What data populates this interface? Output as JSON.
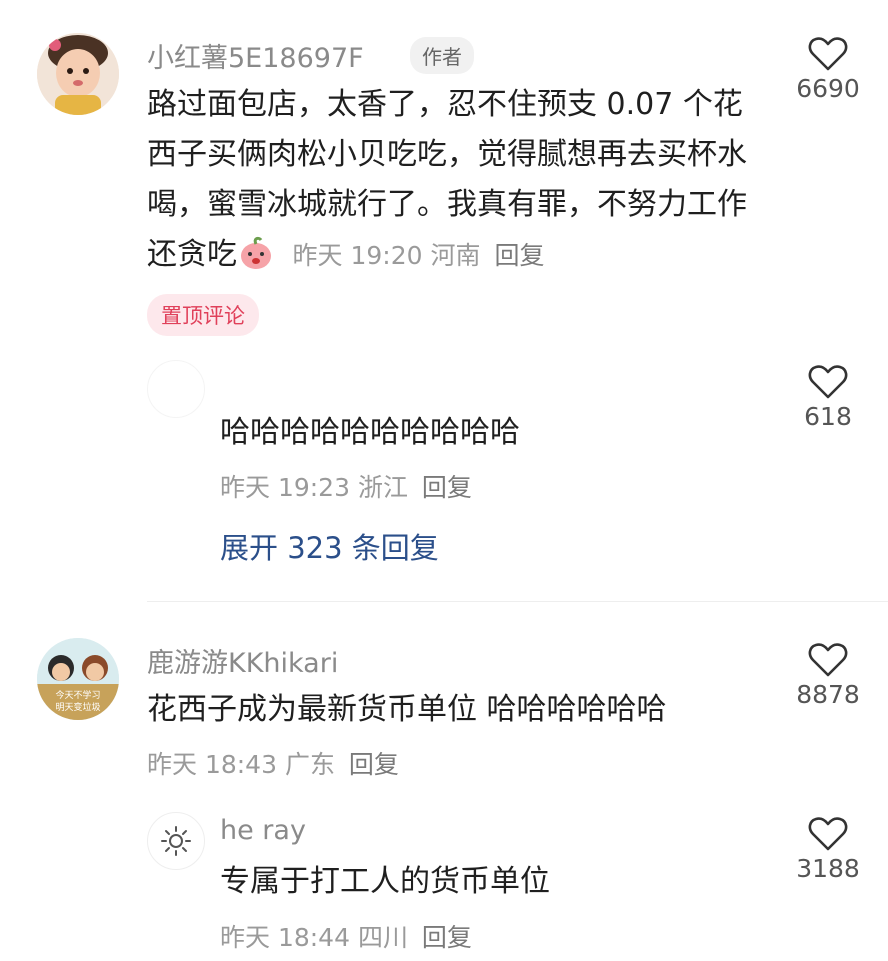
{
  "comments": [
    {
      "name": "小红薯5E18697F",
      "author_tag": "作者",
      "text_before_sticker": "路过面包店，太香了，忍不住预支 0.07 个花西子买俩肉松小贝吃吃，觉得腻想再去买杯水喝，蜜雪冰城就行了。我真有罪，不努力工作还贪吃",
      "time": "昨天 19:20",
      "location": "河南",
      "reply_label": "回复",
      "likes": "6690",
      "pinned_label": "置顶评论",
      "replies": [
        {
          "name": "",
          "text": "哈哈哈哈哈哈哈哈哈哈",
          "time": "昨天 19:23",
          "location": "浙江",
          "reply_label": "回复",
          "likes": "618"
        }
      ],
      "expand_label": "展开 323 条回复"
    },
    {
      "name": "鹿游游KKhikari",
      "text": "花西子成为最新货币单位 哈哈哈哈哈哈",
      "time": "昨天 18:43",
      "location": "广东",
      "reply_label": "回复",
      "likes": "8878",
      "avatar_caption_1": "今天不学习",
      "avatar_caption_2": "明天变垃圾",
      "replies": [
        {
          "name": "he ray",
          "text": "专属于打工人的货币单位",
          "time": "昨天 18:44",
          "location": "四川",
          "reply_label": "回复",
          "likes": "3188"
        }
      ]
    }
  ],
  "colors": {
    "name_gray": "#8a8a8a",
    "expand_blue": "#2b4f8a",
    "pin_red": "#e0405a",
    "pin_bg": "#fde8ec"
  }
}
